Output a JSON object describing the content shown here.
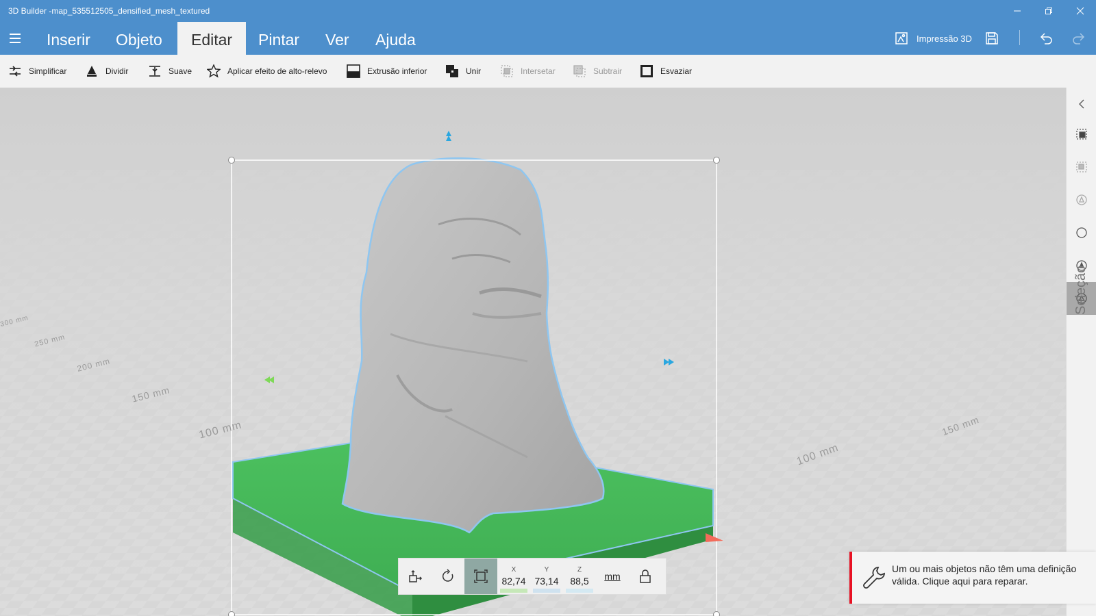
{
  "window": {
    "title": "3D Builder -map_535512505_densified_mesh_textured"
  },
  "menu": {
    "tabs": [
      {
        "label": "Inserir"
      },
      {
        "label": "Objeto"
      },
      {
        "label": "Editar"
      },
      {
        "label": "Pintar"
      },
      {
        "label": "Ver"
      },
      {
        "label": "Ajuda"
      }
    ],
    "active_tab": "Editar",
    "print_label": "Impressão 3D"
  },
  "toolbar": {
    "tools": [
      {
        "label": "Simplificar",
        "icon": "simplify-icon",
        "enabled": true
      },
      {
        "label": "Dividir",
        "icon": "split-icon",
        "enabled": true
      },
      {
        "label": "Suave",
        "icon": "smooth-icon",
        "enabled": true
      },
      {
        "label": "Aplicar efeito de alto-relevo",
        "icon": "emboss-star-icon",
        "enabled": true
      },
      {
        "label": "Extrusão inferior",
        "icon": "extrude-down-icon",
        "enabled": true
      },
      {
        "label": "Unir",
        "icon": "merge-icon",
        "enabled": true
      },
      {
        "label": "Intersetar",
        "icon": "intersect-icon",
        "enabled": false
      },
      {
        "label": "Subtrair",
        "icon": "subtract-icon",
        "enabled": false
      },
      {
        "label": "Esvaziar",
        "icon": "hollow-icon",
        "enabled": true
      }
    ]
  },
  "viewport": {
    "grid_labels": [
      "100 mm",
      "150 mm",
      "200 mm",
      "250 mm",
      "300 mm",
      "100 mm",
      "150 mm"
    ],
    "model_color": "#bdbdbd",
    "base_color": "#46b85a",
    "selection_outline_color": "#8fc6f0"
  },
  "sidepanel": {
    "label": "Seleção"
  },
  "transform": {
    "x_label": "X",
    "y_label": "Y",
    "z_label": "Z",
    "x": "82,74",
    "y": "73,14",
    "z": "88,5",
    "unit": "mm"
  },
  "notification": {
    "message": "Um ou mais objetos não têm uma definição válida. Clique aqui para reparar."
  },
  "colors": {
    "accent": "#4d8fcc",
    "error": "#e81123"
  }
}
